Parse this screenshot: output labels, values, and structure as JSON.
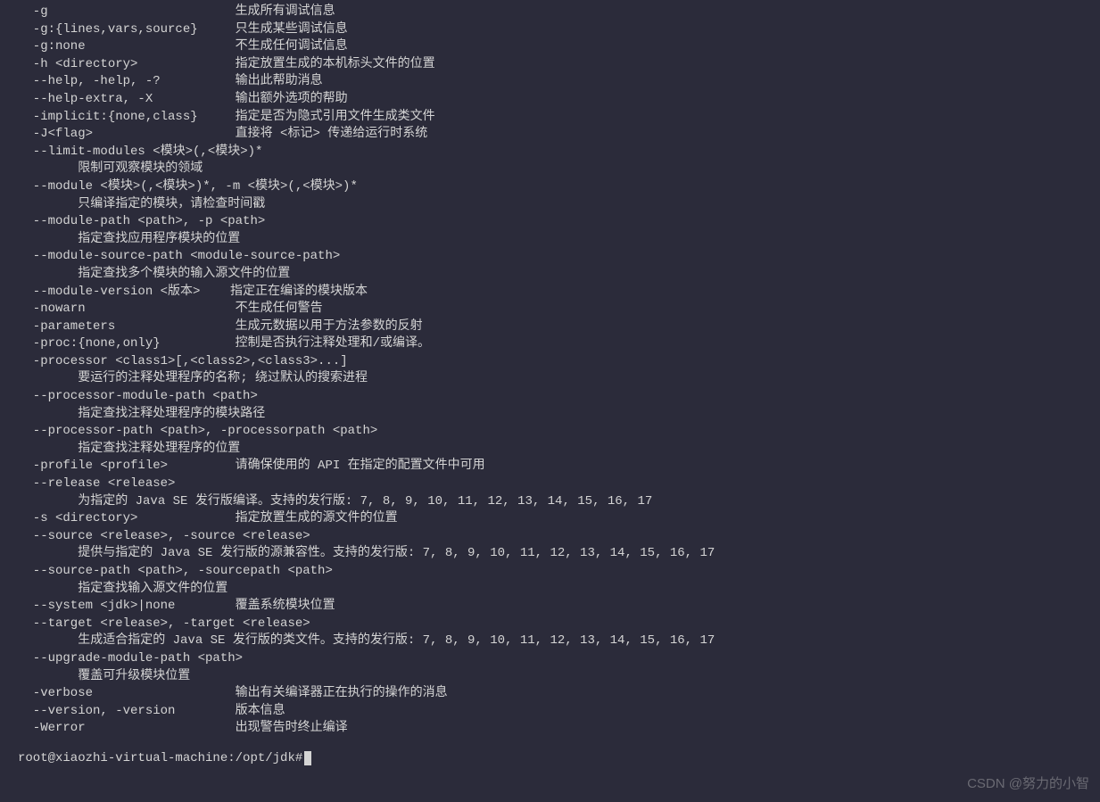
{
  "lines": [
    "  -g                         生成所有调试信息",
    "  -g:{lines,vars,source}     只生成某些调试信息",
    "  -g:none                    不生成任何调试信息",
    "  -h <directory>             指定放置生成的本机标头文件的位置",
    "  --help, -help, -?          输出此帮助消息",
    "  --help-extra, -X           输出额外选项的帮助",
    "  -implicit:{none,class}     指定是否为隐式引用文件生成类文件",
    "  -J<flag>                   直接将 <标记> 传递给运行时系统",
    "  --limit-modules <模块>(,<模块>)*",
    "        限制可观察模块的领域",
    "  --module <模块>(,<模块>)*, -m <模块>(,<模块>)*",
    "        只编译指定的模块，请检查时间戳",
    "  --module-path <path>, -p <path>",
    "        指定查找应用程序模块的位置",
    "  --module-source-path <module-source-path>",
    "        指定查找多个模块的输入源文件的位置",
    "  --module-version <版本>    指定正在编译的模块版本",
    "  -nowarn                    不生成任何警告",
    "  -parameters                生成元数据以用于方法参数的反射",
    "  -proc:{none,only}          控制是否执行注释处理和/或编译。",
    "  -processor <class1>[,<class2>,<class3>...]",
    "        要运行的注释处理程序的名称; 绕过默认的搜索进程",
    "  --processor-module-path <path>",
    "        指定查找注释处理程序的模块路径",
    "  --processor-path <path>, -processorpath <path>",
    "        指定查找注释处理程序的位置",
    "  -profile <profile>         请确保使用的 API 在指定的配置文件中可用",
    "  --release <release>",
    "        为指定的 Java SE 发行版编译。支持的发行版: 7, 8, 9, 10, 11, 12, 13, 14, 15, 16, 17",
    "  -s <directory>             指定放置生成的源文件的位置",
    "  --source <release>, -source <release>",
    "        提供与指定的 Java SE 发行版的源兼容性。支持的发行版: 7, 8, 9, 10, 11, 12, 13, 14, 15, 16, 17",
    "  --source-path <path>, -sourcepath <path>",
    "        指定查找输入源文件的位置",
    "  --system <jdk>|none        覆盖系统模块位置",
    "  --target <release>, -target <release>",
    "        生成适合指定的 Java SE 发行版的类文件。支持的发行版: 7, 8, 9, 10, 11, 12, 13, 14, 15, 16, 17",
    "  --upgrade-module-path <path>",
    "        覆盖可升级模块位置",
    "  -verbose                   输出有关编译器正在执行的操作的消息",
    "  --version, -version        版本信息",
    "  -Werror                    出现警告时终止编译",
    ""
  ],
  "prompt": "root@xiaozhi-virtual-machine:/opt/jdk#",
  "watermark": "CSDN @努力的小智"
}
